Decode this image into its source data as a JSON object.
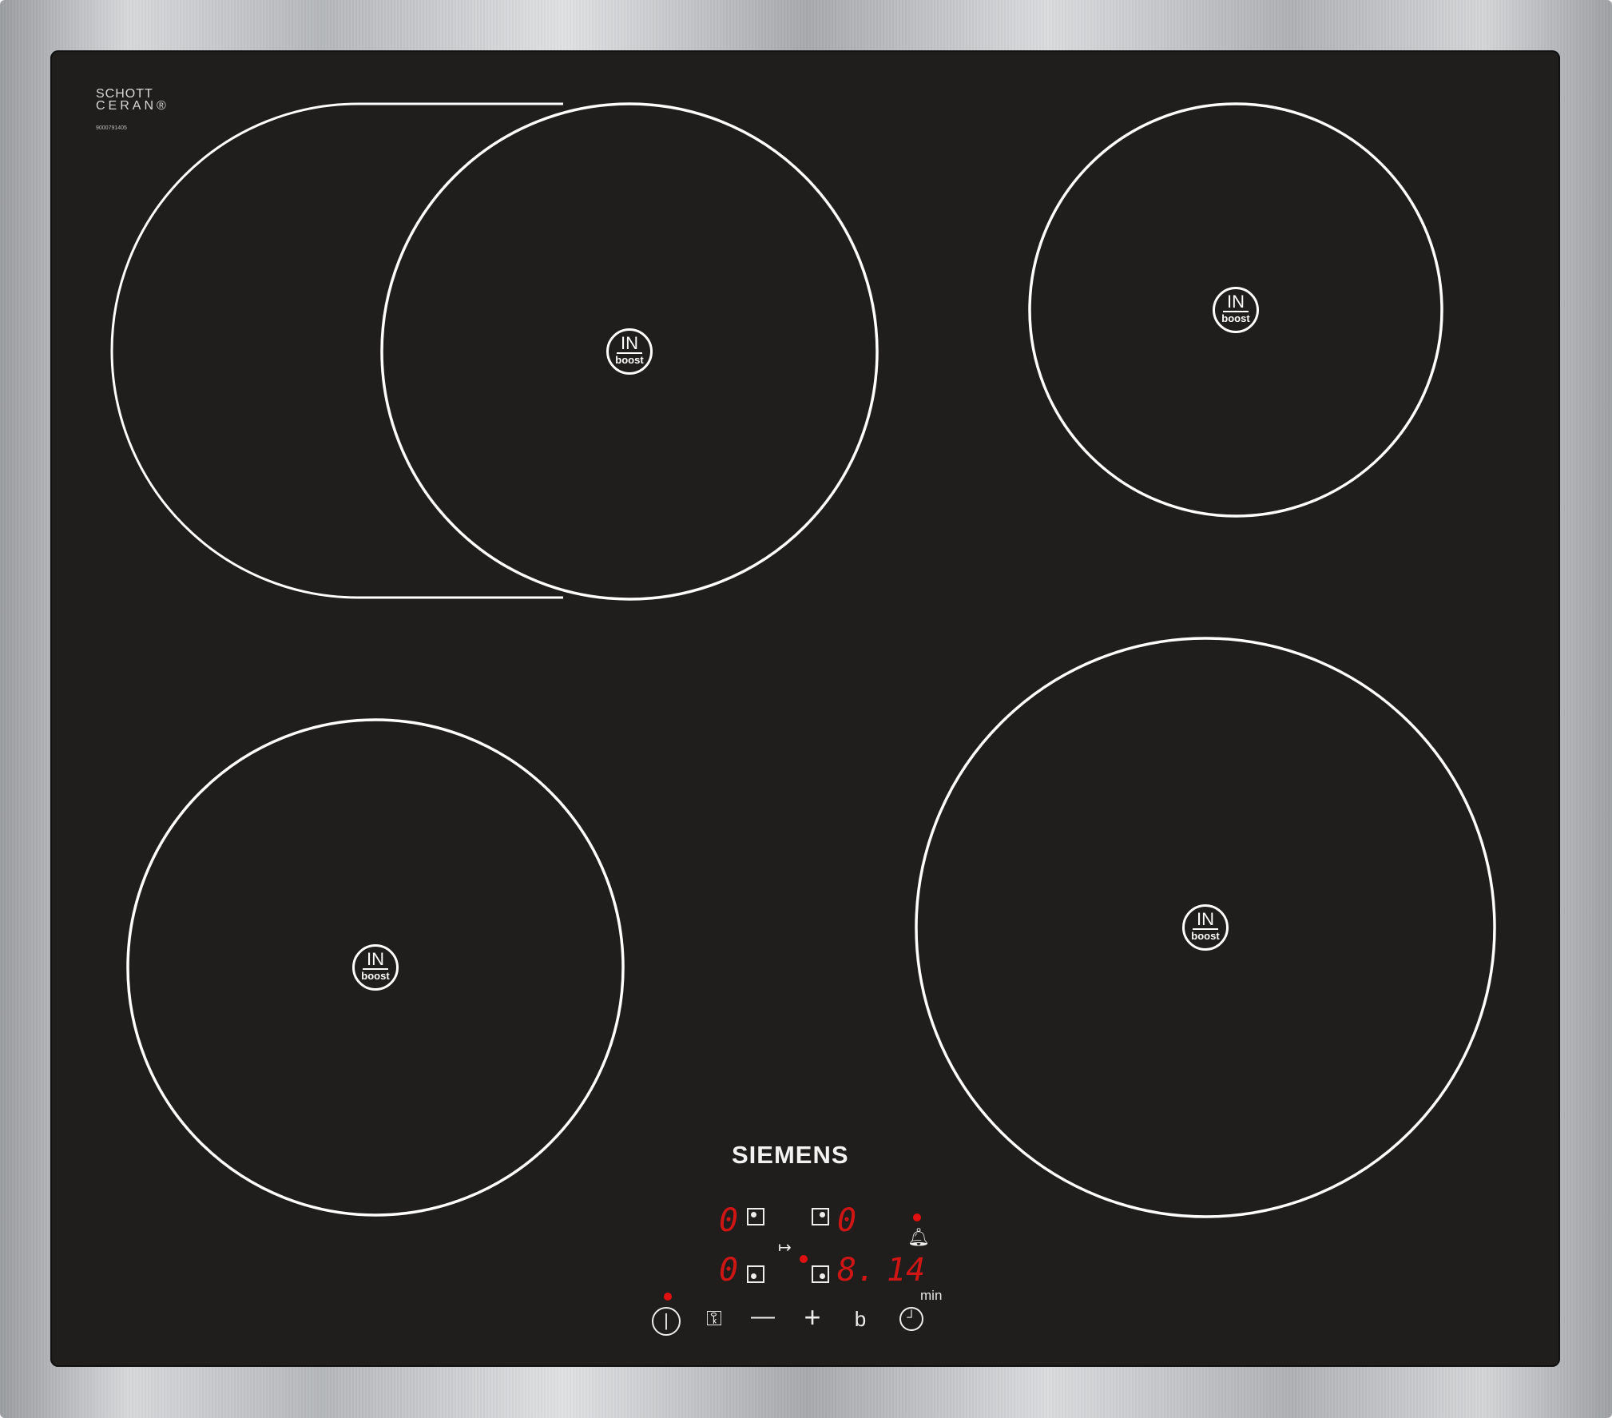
{
  "hob": {
    "brand": "SIEMENS",
    "glass_maker_line1": "SCHOTT",
    "glass_maker_line2": "CERAN®",
    "serial_number": "9000791405",
    "zone_badge_top": "IN",
    "zone_badge_bottom": "boost"
  },
  "control_panel": {
    "zone_displays": [
      "0",
      "0",
      "0",
      "8."
    ],
    "timer_display": "14",
    "timer_unit": "min",
    "buttons": [
      {
        "name": "power-icon",
        "glyph": "⏽"
      },
      {
        "name": "key-lock-icon",
        "glyph": "⚿"
      },
      {
        "name": "minus-icon",
        "glyph": "—"
      },
      {
        "name": "plus-icon",
        "glyph": "+"
      },
      {
        "name": "boost-b-icon",
        "glyph": "b"
      },
      {
        "name": "clock-icon",
        "glyph": "◷"
      }
    ],
    "timer_select_glyph": "↦",
    "colors": {
      "display": "#d01515",
      "glass": "#1f1e1d",
      "print": "#ffffff"
    }
  }
}
